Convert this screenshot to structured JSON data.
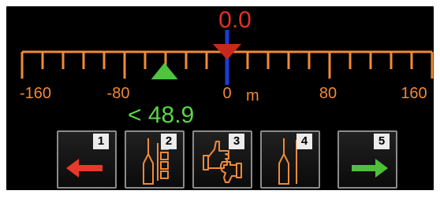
{
  "steering": {
    "offset_value": "0.0",
    "distance_readout": "< 48.9",
    "unit": "m",
    "scale_min": -160,
    "scale_max": 160,
    "current_position": 0,
    "target_position": -48.9,
    "tick_labels": [
      "-160",
      "-80",
      "0",
      "80",
      "160"
    ],
    "colors": {
      "scale": "#f08a38",
      "offset_value": "#e53021",
      "distance": "#5dd44a",
      "center_line": "#1d3bd6"
    }
  },
  "buttons": [
    {
      "number": "1",
      "icon": "arrow-left-icon"
    },
    {
      "number": "2",
      "icon": "implement-sections-icon"
    },
    {
      "number": "3",
      "icon": "thumbs-up-down-icon"
    },
    {
      "number": "4",
      "icon": "implement-guide-icon"
    },
    {
      "number": "5",
      "icon": "arrow-right-icon"
    }
  ]
}
